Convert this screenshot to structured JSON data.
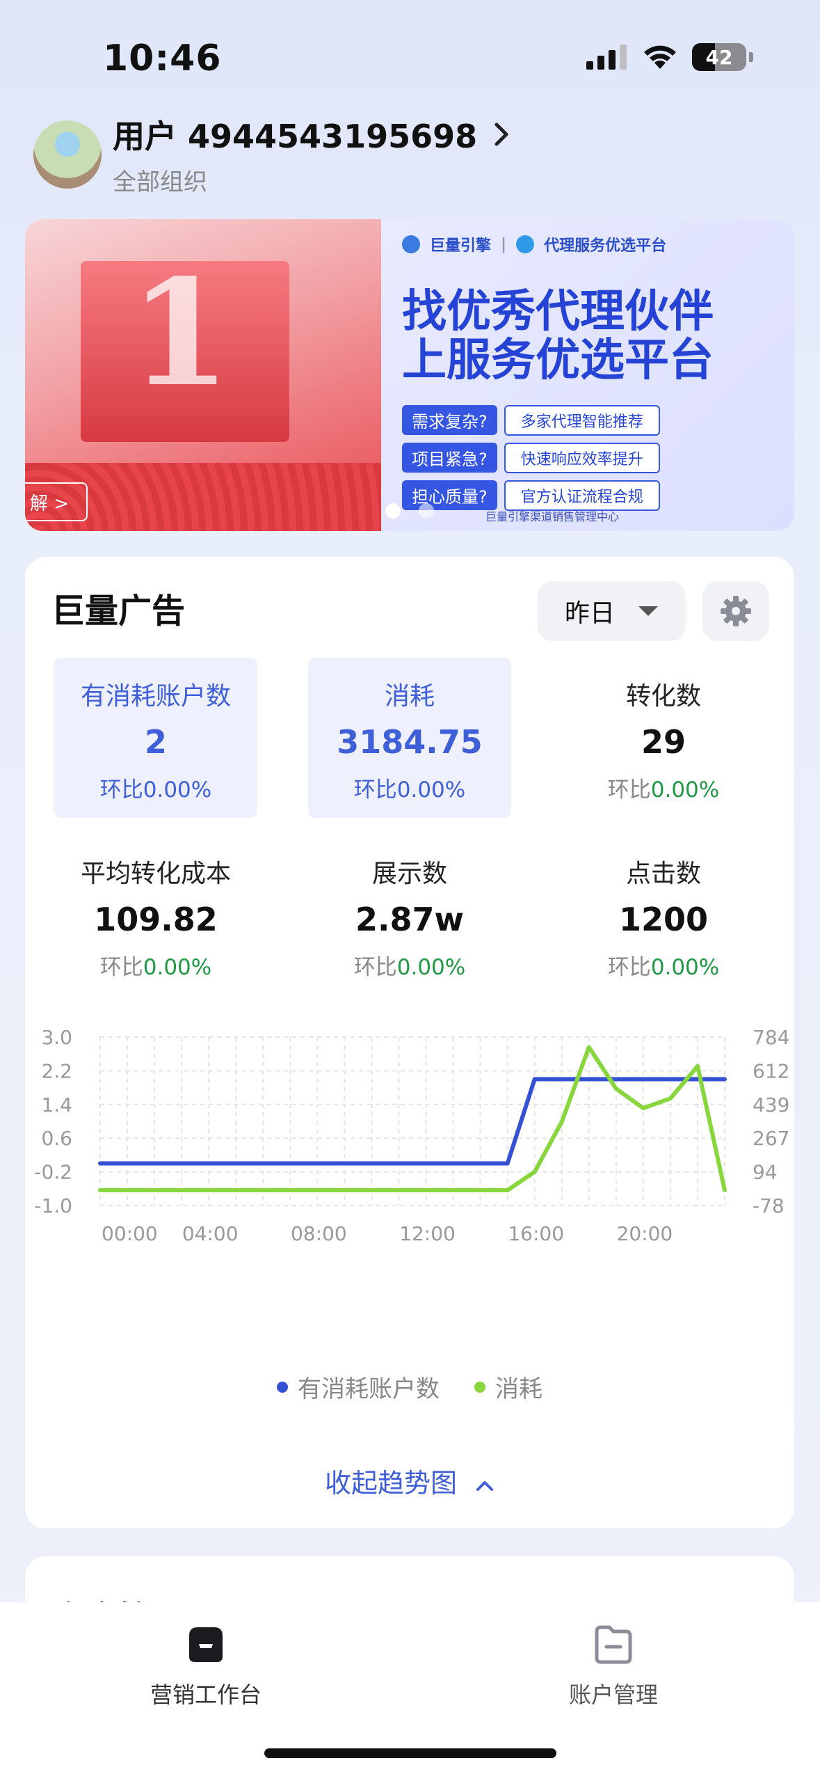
{
  "status_bar": {
    "time": "10:46",
    "battery": "42"
  },
  "user": {
    "name": "用户 4944543195698",
    "org": "全部组织"
  },
  "banner": {
    "left_cta": "解 >",
    "left_number": "1",
    "brand_left": "巨量引擎",
    "brand_right": "代理服务优选平台",
    "title_line1": "找优秀代理伙伴",
    "title_line2": "上服务优选平台",
    "rows": [
      {
        "tag": "需求复杂?",
        "value": "多家代理智能推荐"
      },
      {
        "tag": "项目紧急?",
        "value": "快速响应效率提升"
      },
      {
        "tag": "担心质量?",
        "value": "官方认证流程合规"
      }
    ],
    "footer": "巨量引擎渠道销售管理中心",
    "active_slide": 1,
    "slide_count": 2
  },
  "ad_card": {
    "title": "巨量广告",
    "date_filter": "昨日",
    "metrics": [
      {
        "label": "有消耗账户数",
        "value": "2",
        "cmp_prefix": "环比",
        "cmp": "0.00%",
        "selected": true
      },
      {
        "label": "消耗",
        "value": "3184.75",
        "cmp_prefix": "环比",
        "cmp": "0.00%",
        "selected": true
      },
      {
        "label": "转化数",
        "value": "29",
        "cmp_prefix": "环比",
        "cmp": "0.00%",
        "selected": false
      },
      {
        "label": "平均转化成本",
        "value": "109.82",
        "cmp_prefix": "环比",
        "cmp": "0.00%",
        "selected": false
      },
      {
        "label": "展示数",
        "value": "2.87w",
        "cmp_prefix": "环比",
        "cmp": "0.00%",
        "selected": false
      },
      {
        "label": "点击数",
        "value": "1200",
        "cmp_prefix": "环比",
        "cmp": "0.00%",
        "selected": false
      }
    ],
    "collapse_label": "收起趋势图"
  },
  "chart_data": {
    "type": "line",
    "x": [
      "00:00",
      "01:00",
      "02:00",
      "03:00",
      "04:00",
      "05:00",
      "06:00",
      "07:00",
      "08:00",
      "09:00",
      "10:00",
      "11:00",
      "12:00",
      "13:00",
      "14:00",
      "15:00",
      "16:00",
      "17:00",
      "18:00",
      "19:00",
      "20:00",
      "21:00",
      "22:00",
      "23:00"
    ],
    "x_ticks": [
      "00:00",
      "04:00",
      "08:00",
      "12:00",
      "16:00",
      "20:00"
    ],
    "y_left_ticks": [
      "3.0",
      "2.2",
      "1.4",
      "0.6",
      "-0.2",
      "-1.0"
    ],
    "y_right_ticks": [
      "784",
      "612",
      "439",
      "267",
      "94",
      "-78"
    ],
    "ylim_left": [
      -1.0,
      3.0
    ],
    "ylim_right": [
      -78,
      784
    ],
    "series": [
      {
        "name": "有消耗账户数",
        "axis": "left",
        "color": "#3450d4",
        "values": [
          0,
          0,
          0,
          0,
          0,
          0,
          0,
          0,
          0,
          0,
          0,
          0,
          0,
          0,
          0,
          0,
          2,
          2,
          2,
          2,
          2,
          2,
          2,
          2
        ]
      },
      {
        "name": "消耗",
        "axis": "right",
        "color": "#86d63c",
        "values": [
          0,
          0,
          0,
          0,
          0,
          0,
          0,
          0,
          0,
          0,
          0,
          0,
          0,
          0,
          0,
          0,
          94,
          350,
          732,
          520,
          420,
          470,
          635,
          0
        ]
      }
    ],
    "grid": true
  },
  "tabbar": {
    "items": [
      {
        "label": "营销工作台",
        "active": true
      },
      {
        "label": "账户管理",
        "active": false
      }
    ]
  },
  "partial_card": {
    "title": "资金管理"
  }
}
